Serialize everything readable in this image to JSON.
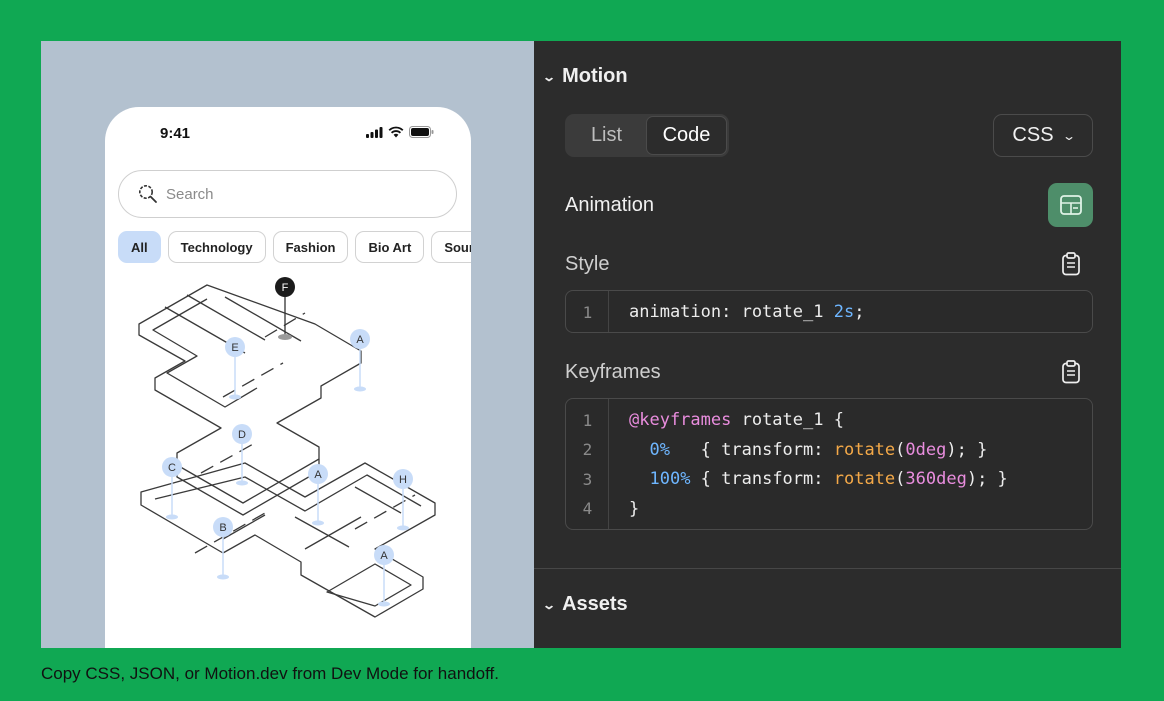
{
  "phone": {
    "time": "9:41",
    "search_placeholder": "Search",
    "chips": [
      "All",
      "Technology",
      "Fashion",
      "Bio Art",
      "Sound"
    ],
    "map_pins": [
      "F",
      "E",
      "A",
      "D",
      "C",
      "A",
      "H",
      "B",
      "A"
    ]
  },
  "panel": {
    "motion_title": "Motion",
    "tabs": [
      "List",
      "Code"
    ],
    "active_tab": "Code",
    "language": "CSS",
    "animation_label": "Animation",
    "style_label": "Style",
    "style_code": [
      {
        "n": "1",
        "parts": [
          {
            "t": "animation: rotate_1 ",
            "c": ""
          },
          {
            "t": "2s",
            "c": "num"
          },
          {
            "t": ";",
            "c": ""
          }
        ]
      }
    ],
    "keyframes_label": "Keyframes",
    "keyframes_code": [
      {
        "n": "1",
        "parts": [
          {
            "t": "@keyframes",
            "c": "kw"
          },
          {
            "t": " rotate_1 {",
            "c": ""
          }
        ]
      },
      {
        "n": "2",
        "parts": [
          {
            "t": "  ",
            "c": ""
          },
          {
            "t": "0%",
            "c": "num"
          },
          {
            "t": "   { transform: ",
            "c": ""
          },
          {
            "t": "rotate",
            "c": "fn"
          },
          {
            "t": "(",
            "c": ""
          },
          {
            "t": "0deg",
            "c": "kw"
          },
          {
            "t": "); }",
            "c": ""
          }
        ]
      },
      {
        "n": "3",
        "parts": [
          {
            "t": "  ",
            "c": ""
          },
          {
            "t": "100%",
            "c": "num"
          },
          {
            "t": " { transform: ",
            "c": ""
          },
          {
            "t": "rotate",
            "c": "fn"
          },
          {
            "t": "(",
            "c": ""
          },
          {
            "t": "360deg",
            "c": "kw"
          },
          {
            "t": "); }",
            "c": ""
          }
        ]
      },
      {
        "n": "4",
        "parts": [
          {
            "t": "}",
            "c": ""
          }
        ]
      }
    ],
    "assets_title": "Assets"
  },
  "caption": "Copy CSS, JSON, or Motion.dev from Dev Mode for handoff.",
  "colors": {
    "background": "#10a853",
    "panel": "#2c2c2c",
    "preview": "#b3c1cf",
    "pin": "#c8dcf8",
    "accent_button": "#4e8e6a"
  }
}
